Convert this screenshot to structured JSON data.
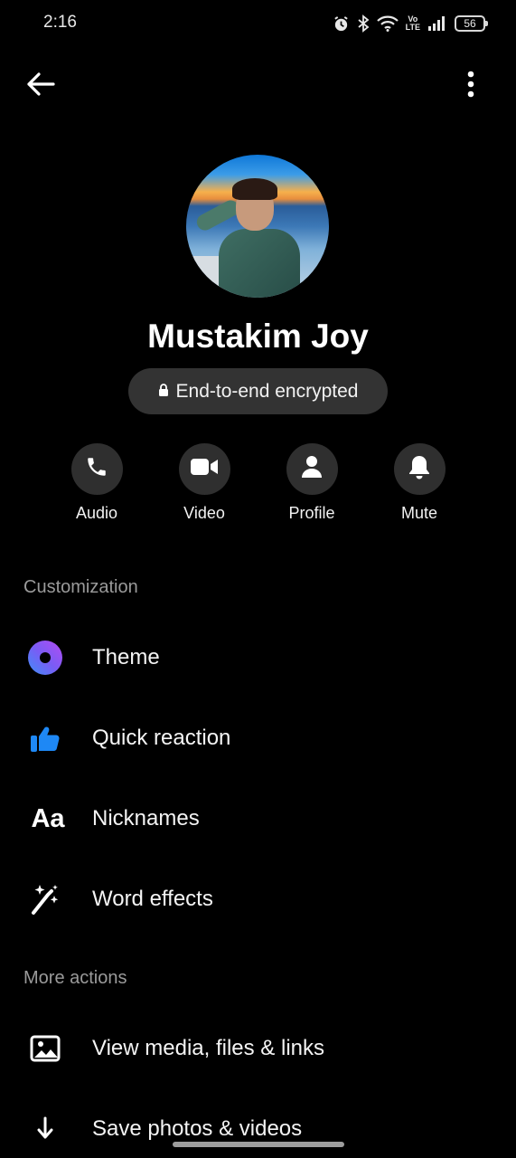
{
  "status_bar": {
    "time": "2:16",
    "network_label_top": "Vo",
    "network_label_bottom": "LTE",
    "battery": "56"
  },
  "top_bar": {
    "back_icon": "arrow-left-icon",
    "more_icon": "more-vertical-icon"
  },
  "profile": {
    "name": "Mustakim Joy",
    "encryption_label": "End-to-end encrypted"
  },
  "actions": [
    {
      "label": "Audio",
      "icon": "phone-icon"
    },
    {
      "label": "Video",
      "icon": "video-camera-icon"
    },
    {
      "label": "Profile",
      "icon": "person-icon"
    },
    {
      "label": "Mute",
      "icon": "bell-icon"
    }
  ],
  "customization": {
    "title": "Customization",
    "items": [
      {
        "label": "Theme",
        "icon": "theme-icon"
      },
      {
        "label": "Quick reaction",
        "icon": "thumbs-up-icon"
      },
      {
        "label": "Nicknames",
        "icon": "nicknames-icon",
        "icon_text": "Aa"
      },
      {
        "label": "Word effects",
        "icon": "magic-wand-icon"
      }
    ]
  },
  "more_actions": {
    "title": "More actions",
    "items": [
      {
        "label": "View media, files & links",
        "icon": "image-icon"
      },
      {
        "label": "Save photos & videos",
        "icon": "download-icon"
      }
    ]
  },
  "colors": {
    "background": "#000000",
    "accent_blue": "#1e88f5",
    "theme_gradient_start": "#5b6cf7",
    "theme_gradient_end": "#b44bf2"
  }
}
